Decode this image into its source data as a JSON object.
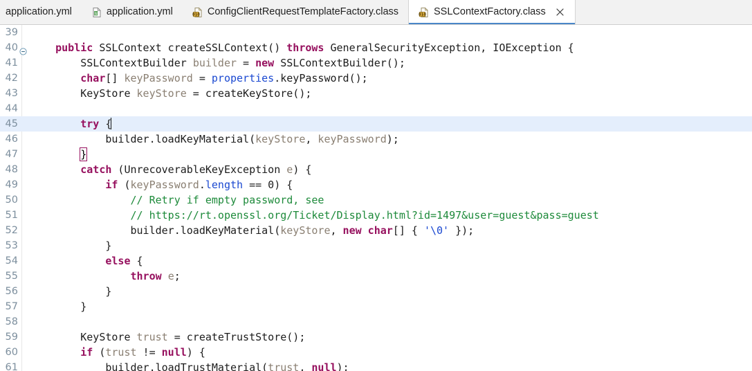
{
  "window": {
    "app": "eclipse-java-editor",
    "accent_color": "#4a86c8",
    "current_line_highlight": "#e4eefc",
    "tabbar_background": "#f2f2f2"
  },
  "tabbar": {
    "tabs": [
      {
        "label": "application.yml",
        "icon": "none",
        "active": false,
        "closable": false
      },
      {
        "label": "application.yml",
        "icon": "yaml-file-icon",
        "active": false,
        "closable": false
      },
      {
        "label": "ConfigClientRequestTemplateFactory.class",
        "icon": "class-file-icon",
        "active": false,
        "closable": false
      },
      {
        "label": "SSLContextFactory.class",
        "icon": "class-file-icon",
        "active": true,
        "closable": true
      }
    ],
    "close_icon": "close-icon"
  },
  "editor": {
    "file": "SSLContextFactory.class",
    "cursor_line": 45,
    "first_visible_line": 39,
    "lines": [
      {
        "no": "39",
        "fold": false,
        "current": false,
        "tokens": []
      },
      {
        "no": "40",
        "fold": true,
        "current": false,
        "tokens": [
          {
            "t": "    ",
            "c": "plain"
          },
          {
            "t": "public",
            "c": "kw"
          },
          {
            "t": " ",
            "c": "plain"
          },
          {
            "t": "SSLContext",
            "c": "type"
          },
          {
            "t": " createSSLContext() ",
            "c": "plain"
          },
          {
            "t": "throws",
            "c": "kw"
          },
          {
            "t": " GeneralSecurityException, IOException {",
            "c": "plain"
          }
        ]
      },
      {
        "no": "41",
        "fold": false,
        "current": false,
        "tokens": [
          {
            "t": "        SSLContextBuilder ",
            "c": "plain"
          },
          {
            "t": "builder",
            "c": "var"
          },
          {
            "t": " = ",
            "c": "plain"
          },
          {
            "t": "new",
            "c": "kw"
          },
          {
            "t": " SSLContextBuilder();",
            "c": "plain"
          }
        ]
      },
      {
        "no": "42",
        "fold": false,
        "current": false,
        "tokens": [
          {
            "t": "        ",
            "c": "plain"
          },
          {
            "t": "char",
            "c": "kw"
          },
          {
            "t": "[] ",
            "c": "plain"
          },
          {
            "t": "keyPassword",
            "c": "var"
          },
          {
            "t": " = ",
            "c": "plain"
          },
          {
            "t": "properties",
            "c": "fld"
          },
          {
            "t": ".keyPassword();",
            "c": "plain"
          }
        ]
      },
      {
        "no": "43",
        "fold": false,
        "current": false,
        "tokens": [
          {
            "t": "        KeyStore ",
            "c": "plain"
          },
          {
            "t": "keyStore",
            "c": "var"
          },
          {
            "t": " = createKeyStore();",
            "c": "plain"
          }
        ]
      },
      {
        "no": "44",
        "fold": false,
        "current": false,
        "tokens": []
      },
      {
        "no": "45",
        "fold": false,
        "current": true,
        "tokens": [
          {
            "t": "        ",
            "c": "plain"
          },
          {
            "t": "try",
            "c": "kw"
          },
          {
            "t": " {",
            "c": "plain"
          },
          {
            "t": "",
            "c": "caret"
          }
        ]
      },
      {
        "no": "46",
        "fold": false,
        "current": false,
        "tokens": [
          {
            "t": "            builder.loadKeyMaterial(",
            "c": "plain"
          },
          {
            "t": "keyStore",
            "c": "var"
          },
          {
            "t": ", ",
            "c": "plain"
          },
          {
            "t": "keyPassword",
            "c": "var"
          },
          {
            "t": ");",
            "c": "plain"
          }
        ]
      },
      {
        "no": "47",
        "fold": false,
        "current": false,
        "tokens": [
          {
            "t": "        ",
            "c": "plain"
          },
          {
            "t": "}",
            "c": "bracketbox"
          }
        ]
      },
      {
        "no": "48",
        "fold": false,
        "current": false,
        "tokens": [
          {
            "t": "        ",
            "c": "plain"
          },
          {
            "t": "catch",
            "c": "kw"
          },
          {
            "t": " (UnrecoverableKeyException ",
            "c": "plain"
          },
          {
            "t": "e",
            "c": "var"
          },
          {
            "t": ") {",
            "c": "plain"
          }
        ]
      },
      {
        "no": "49",
        "fold": false,
        "current": false,
        "tokens": [
          {
            "t": "            ",
            "c": "plain"
          },
          {
            "t": "if",
            "c": "kw"
          },
          {
            "t": " (",
            "c": "plain"
          },
          {
            "t": "keyPassword",
            "c": "var"
          },
          {
            "t": ".",
            "c": "plain"
          },
          {
            "t": "length",
            "c": "fld"
          },
          {
            "t": " == 0) {",
            "c": "plain"
          }
        ]
      },
      {
        "no": "50",
        "fold": false,
        "current": false,
        "tokens": [
          {
            "t": "                ",
            "c": "plain"
          },
          {
            "t": "// Retry if empty password, see",
            "c": "cmt"
          }
        ]
      },
      {
        "no": "51",
        "fold": false,
        "current": false,
        "tokens": [
          {
            "t": "                ",
            "c": "plain"
          },
          {
            "t": "// https://rt.openssl.org/Ticket/Display.html?id=1497&user=guest&pass=guest",
            "c": "cmt"
          }
        ]
      },
      {
        "no": "52",
        "fold": false,
        "current": false,
        "tokens": [
          {
            "t": "                builder.loadKeyMaterial(",
            "c": "plain"
          },
          {
            "t": "keyStore",
            "c": "var"
          },
          {
            "t": ", ",
            "c": "plain"
          },
          {
            "t": "new",
            "c": "kw"
          },
          {
            "t": " ",
            "c": "plain"
          },
          {
            "t": "char",
            "c": "kw"
          },
          {
            "t": "[] { ",
            "c": "plain"
          },
          {
            "t": "'\\0'",
            "c": "lit"
          },
          {
            "t": " });",
            "c": "plain"
          }
        ]
      },
      {
        "no": "53",
        "fold": false,
        "current": false,
        "tokens": [
          {
            "t": "            }",
            "c": "plain"
          }
        ]
      },
      {
        "no": "54",
        "fold": false,
        "current": false,
        "tokens": [
          {
            "t": "            ",
            "c": "plain"
          },
          {
            "t": "else",
            "c": "kw"
          },
          {
            "t": " {",
            "c": "plain"
          }
        ]
      },
      {
        "no": "55",
        "fold": false,
        "current": false,
        "tokens": [
          {
            "t": "                ",
            "c": "plain"
          },
          {
            "t": "throw",
            "c": "kw"
          },
          {
            "t": " ",
            "c": "plain"
          },
          {
            "t": "e",
            "c": "var"
          },
          {
            "t": ";",
            "c": "plain"
          }
        ]
      },
      {
        "no": "56",
        "fold": false,
        "current": false,
        "tokens": [
          {
            "t": "            }",
            "c": "plain"
          }
        ]
      },
      {
        "no": "57",
        "fold": false,
        "current": false,
        "tokens": [
          {
            "t": "        }",
            "c": "plain"
          }
        ]
      },
      {
        "no": "58",
        "fold": false,
        "current": false,
        "tokens": []
      },
      {
        "no": "59",
        "fold": false,
        "current": false,
        "tokens": [
          {
            "t": "        KeyStore ",
            "c": "plain"
          },
          {
            "t": "trust",
            "c": "var"
          },
          {
            "t": " = createTrustStore();",
            "c": "plain"
          }
        ]
      },
      {
        "no": "60",
        "fold": false,
        "current": false,
        "tokens": [
          {
            "t": "        ",
            "c": "plain"
          },
          {
            "t": "if",
            "c": "kw"
          },
          {
            "t": " (",
            "c": "plain"
          },
          {
            "t": "trust",
            "c": "var"
          },
          {
            "t": " != ",
            "c": "plain"
          },
          {
            "t": "null",
            "c": "kw"
          },
          {
            "t": ") {",
            "c": "plain"
          }
        ]
      },
      {
        "no": "61",
        "fold": false,
        "current": false,
        "tokens": [
          {
            "t": "            builder.loadTrustMaterial(",
            "c": "plain"
          },
          {
            "t": "trust",
            "c": "var"
          },
          {
            "t": ", ",
            "c": "plain"
          },
          {
            "t": "null",
            "c": "kw"
          },
          {
            "t": ");",
            "c": "plain"
          }
        ]
      }
    ]
  }
}
